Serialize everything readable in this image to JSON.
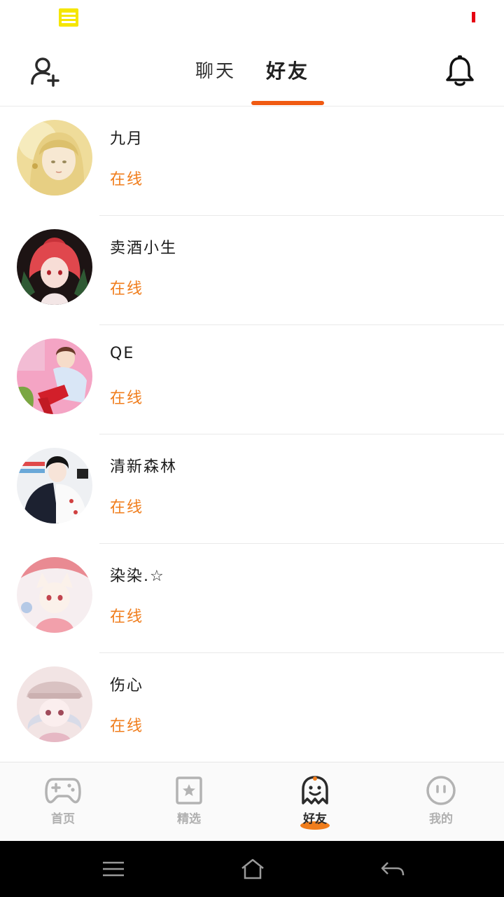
{
  "status_bar": {
    "left_icon": "notes-icon",
    "right_icon": "battery-low-icon",
    "left_color": "#f5e600",
    "right_color": "#e60012"
  },
  "header": {
    "left_icon": "add-friend-icon",
    "right_icon": "bell-icon",
    "tabs": [
      {
        "label": "聊天",
        "active": false
      },
      {
        "label": "好友",
        "active": true
      }
    ],
    "accent_color": "#f05a12"
  },
  "friends": [
    {
      "name": "九月",
      "status": "在线",
      "avatar": "avatar-blonde-girl"
    },
    {
      "name": "卖酒小生",
      "status": "在线",
      "avatar": "avatar-red-hair-girl"
    },
    {
      "name": "QE",
      "status": "在线",
      "avatar": "avatar-boy-pink-background"
    },
    {
      "name": "清新森林",
      "status": "在线",
      "avatar": "avatar-boy-dark-jacket"
    },
    {
      "name": "染染.☆",
      "status": "在线",
      "avatar": "avatar-cat-ear-girl"
    },
    {
      "name": "伤心",
      "status": "在线",
      "avatar": "avatar-white-hair-hat"
    }
  ],
  "bottom_nav": [
    {
      "label": "首页",
      "icon": "gamepad-icon",
      "active": false
    },
    {
      "label": "精选",
      "icon": "star-card-icon",
      "active": false
    },
    {
      "label": "好友",
      "icon": "ghost-icon",
      "active": true
    },
    {
      "label": "我的",
      "icon": "face-icon",
      "active": false
    }
  ],
  "status_color": "#f07d1c",
  "system_nav": [
    "menu-icon",
    "home-icon",
    "back-icon"
  ]
}
